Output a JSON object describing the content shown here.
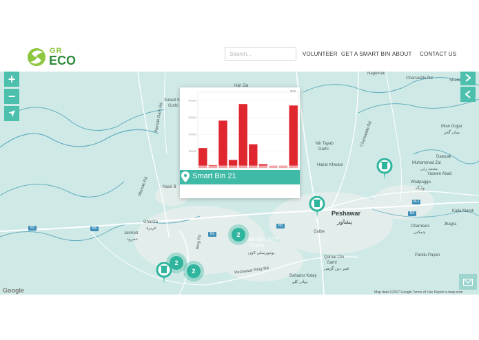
{
  "brand": {
    "logo_top": "GR",
    "logo_bottom": "ECO",
    "colors": {
      "accent": "#4dc0ad",
      "brand_light": "#8dc63f",
      "brand_dark": "#2f8a3b"
    }
  },
  "header": {
    "search_placeholder": "Search...",
    "nav": [
      {
        "label": "VOLUNTEER"
      },
      {
        "label": "GET A SMART BIN"
      },
      {
        "label": "ABOUT"
      },
      {
        "label": "CONTACT US"
      }
    ]
  },
  "map": {
    "controls": {
      "zoom_in": "+",
      "zoom_out": "−",
      "locate_icon": "navigation-arrow-icon",
      "next_icon": "chevron-right-icon",
      "prev_icon": "chevron-left-icon"
    },
    "labels": {
      "naguman": "Naguman",
      "charsadda_rd": "Charsadda Rd",
      "sheikh_kalay": "Sheikh Kalay",
      "hijri_zai": "Hijri Zai",
      "sufaid_sang": "Sufaid S",
      "gurbi": "Gurbi",
      "warsak_dam_rd": "Warsak Dam Rd",
      "warsak_rd": "Warsak Rd",
      "mian_gujjar": "Mian Gujjar",
      "mian_gujjar_ur": "میاں گجر",
      "mir_tayab_garhi": "Mir Tayab",
      "mir_tayab_garhi2": "Garhi",
      "dalazak": "Dalazak",
      "muhammad_zai": "Muhammad Zai",
      "muhammad_zai_ur": "محمد زئی",
      "yaseen_abad": "Yaseen Abad",
      "wadpagga": "Wadpagga",
      "wadpagga_ur": "وڈپگہ",
      "hazar_khwani": "Hazar Khwani",
      "nasir_bagh": "Nasir B",
      "kaila_mandi": "Kaila Mandi",
      "peshawar": "Peshawar",
      "peshawar_ur": "پشاور",
      "jhagra": "Jhagra",
      "chamkani": "Chamkani",
      "chamkani_ur": "چمکنی",
      "gharizai": "Ghariza",
      "gharizai_ur": "غریزہ",
      "jamrud": "Jamrud",
      "jamrud_ur": "جمرود",
      "university_town": "UNIVERSITY",
      "university_town2": "TOWN",
      "university_town_ur": "یونیورسٹی ٹاؤن",
      "gulberg": "Gulbe",
      "qamar_din_garhi": "Qamar Din",
      "qamar_din_garhi2": "Garhi",
      "qamar_din_garhi_ur": "قمر دین گڑھی",
      "bahadur_kalay": "Bahadur Kalay",
      "bahadur_kalay_ur": "بہادر کلے",
      "pandu_payan": "Pandu Payan",
      "peshawar_ring_rd": "Peshawar Ring Rd",
      "ring_rd": "Ring Rd",
      "n5": "N5",
      "m1": "M-1"
    },
    "clusters": [
      {
        "count": "2"
      },
      {
        "count": "2"
      },
      {
        "count": "2"
      }
    ],
    "google": "Google",
    "attribution": "Map data ©2017 Google   Terms of Use   Report a map error"
  },
  "popup": {
    "title": "Smart Bin 21",
    "close_label": "×"
  },
  "chart_data": {
    "type": "bar",
    "title": "",
    "ylabel": "",
    "bar_color": "#e0262f",
    "values": [
      0.42,
      0.06,
      1.0,
      0.17,
      1.35,
      0.5,
      0.08,
      0.03,
      0.03,
      1.32
    ],
    "baseline_values": [
      0.05,
      0.05,
      0.05,
      0.05,
      0.05,
      0.05,
      0.05,
      0.05,
      0.05,
      0.05
    ],
    "ylim": [
      0,
      1.6
    ],
    "y_tick_labels": [
      "400000",
      "300000",
      "200000",
      "100000"
    ]
  },
  "footer": {
    "mail_icon": "mail-icon"
  }
}
